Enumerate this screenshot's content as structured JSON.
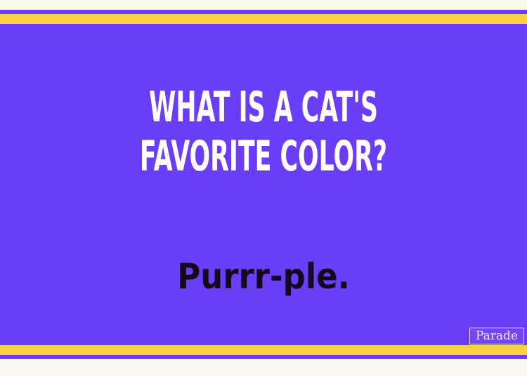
{
  "card": {
    "question_lines": [
      "WHAT IS A CAT'S",
      "FAVORITE COLOR?"
    ],
    "answer": "Purrr-ple.",
    "watermark": "Parade"
  },
  "colors": {
    "panel": "#6c3df7",
    "stripe_yellow": "#f8cf45",
    "background": "#fbf7ee",
    "question_text": "#ffffff",
    "answer_text": "#120a1c"
  }
}
